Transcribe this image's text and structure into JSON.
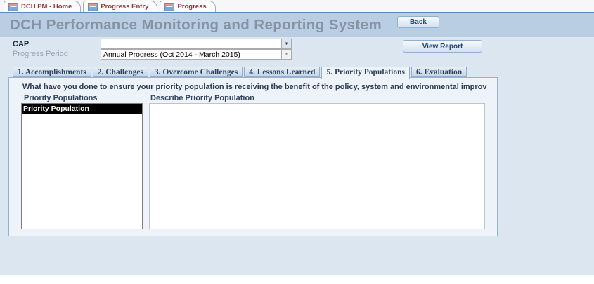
{
  "colors": {
    "header_band": "#b9cde3",
    "body_background": "#dce6f1",
    "panel_background": "#eef2f9",
    "panel_border": "#8eb3e0",
    "doc_tab_text": "#943634",
    "title_text": "#8593a5",
    "selected_item_bg": "#000000",
    "selected_item_text": "#ffffff",
    "button_text": "#24466b"
  },
  "icons": {
    "dropdown": "▼",
    "form_icon": "access-form-icon"
  },
  "window_tabs": [
    {
      "label": "DCH PM - Home"
    },
    {
      "label": "Progress Entry"
    },
    {
      "label": "Progress",
      "active": true
    }
  ],
  "header": {
    "title": "DCH Performance Monitoring and Reporting System",
    "back_button": "Back"
  },
  "toolbar": {
    "cap_label": "CAP",
    "cap_value": "",
    "progress_period_label": "Progress Period",
    "progress_period_value": "Annual Progress (Oct 2014 - March 2015)",
    "view_report_button": "View Report"
  },
  "tabs": [
    {
      "label": "1. Accomplishments",
      "active": false
    },
    {
      "label": "2. Challenges",
      "active": false
    },
    {
      "label": "3. Overcome Challenges",
      "active": false
    },
    {
      "label": "4. Lessons Learned",
      "active": false
    },
    {
      "label": "5. Priority Populations",
      "active": true
    },
    {
      "label": "6. Evaluation",
      "active": false
    }
  ],
  "panel": {
    "question": "What have you done to ensure your priority population is receiving the benefit of the policy, system and environmental improv",
    "list_label": "Priority Populations",
    "list_items": [
      {
        "label": "Priority Population",
        "selected": true
      }
    ],
    "describe_label": "Describe Priority Population",
    "describe_value": ""
  }
}
